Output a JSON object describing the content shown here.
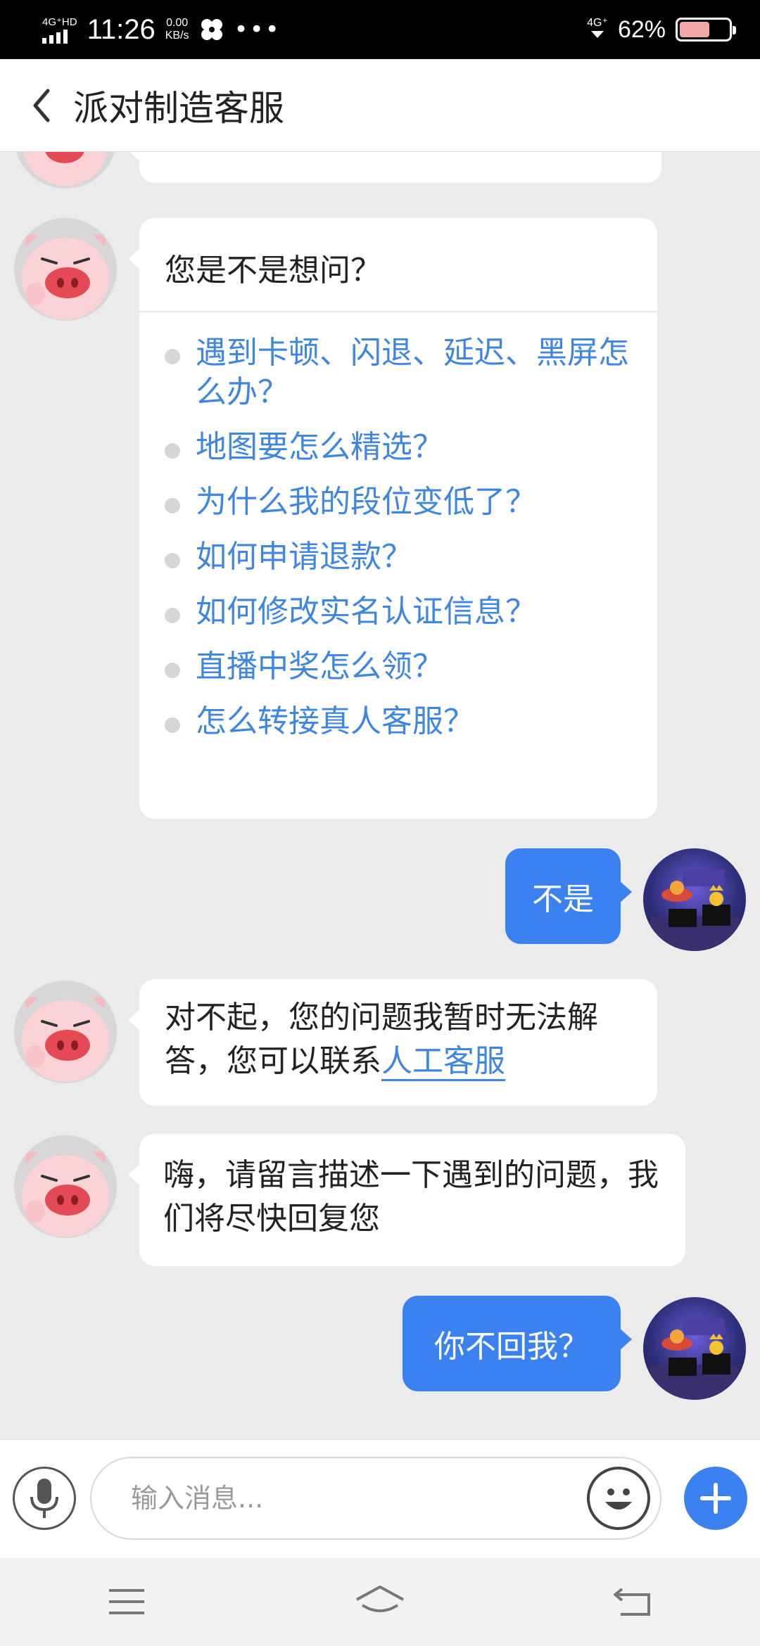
{
  "status_bar": {
    "network": "4G⁺HD",
    "time": "11:26",
    "speed_value": "0.00",
    "speed_unit": "KB/s",
    "more": "•••",
    "network_right": "4G⁺",
    "battery_percent": "62%",
    "battery_level": 0.62
  },
  "header": {
    "title": "派对制造客服"
  },
  "messages": {
    "faq": {
      "heading": "您是不是想问？",
      "items": [
        "遇到卡顿、闪退、延迟、黑屏怎么办？",
        "地图要怎么精选？",
        "为什么我的段位变低了？",
        "如何申请退款？",
        "如何修改实名认证信息？",
        "直播中奖怎么领？",
        "怎么转接真人客服？"
      ]
    },
    "user_reply_1": "不是",
    "bot_reply_1_text": "对不起，您的问题我暂时无法解答，您可以联系",
    "bot_reply_1_link": "人工客服",
    "bot_reply_2": "嗨，请留言描述一下遇到的问题，我们将尽快回复您",
    "user_reply_2": "你不回我？"
  },
  "input": {
    "placeholder": "输入消息..."
  },
  "colors": {
    "accent": "#3b82f0",
    "link": "#3f86e0",
    "chat_bg": "#ebebeb"
  }
}
